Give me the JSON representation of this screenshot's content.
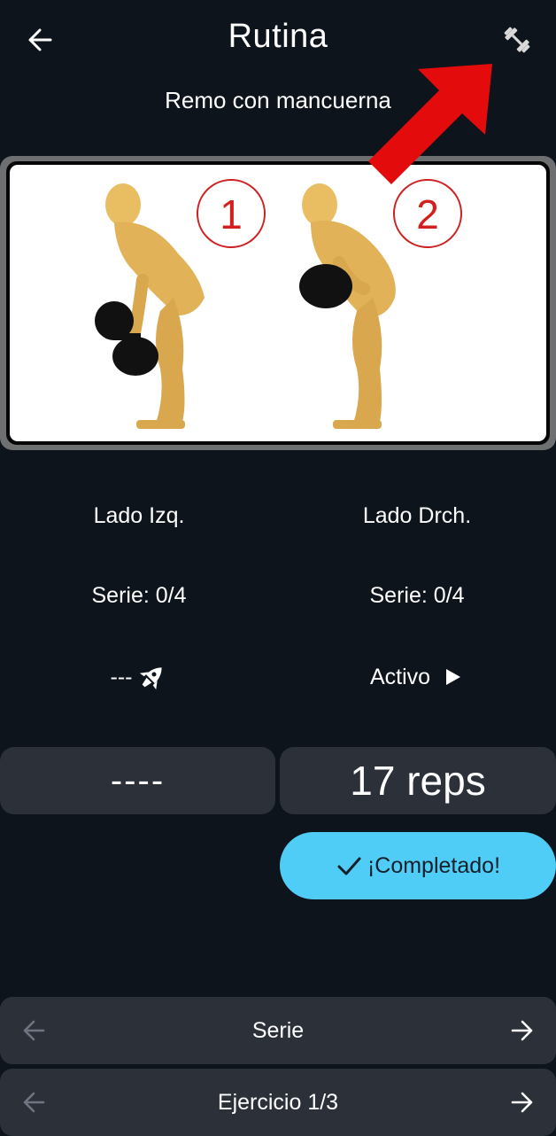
{
  "header": {
    "title": "Rutina",
    "subtitle": "Remo con mancuerna",
    "back_icon": "arrow-left-icon",
    "equipment_icon": "dumbbell-icon"
  },
  "image": {
    "step_labels": [
      "1",
      "2"
    ],
    "description_icon": "exercise-illustration"
  },
  "sides": {
    "left": {
      "label": "Lado Izq.",
      "series": "Serie: 0/4",
      "status": "---",
      "status_icon": "rocket-icon"
    },
    "right": {
      "label": "Lado Drch.",
      "series": "Serie: 0/4",
      "status": "Activo",
      "status_icon": "play-icon"
    }
  },
  "counters": {
    "left": "----",
    "right": "17 reps"
  },
  "actions": {
    "complete_label": "¡Completado!",
    "complete_icon": "check-icon"
  },
  "nav": {
    "series_label": "Serie",
    "exercise_label": "Ejercicio 1/3"
  },
  "colors": {
    "background": "#0e141b",
    "panel": "#2b3039",
    "accent": "#4fcdf6",
    "annotation_arrow": "#e30b0b"
  }
}
